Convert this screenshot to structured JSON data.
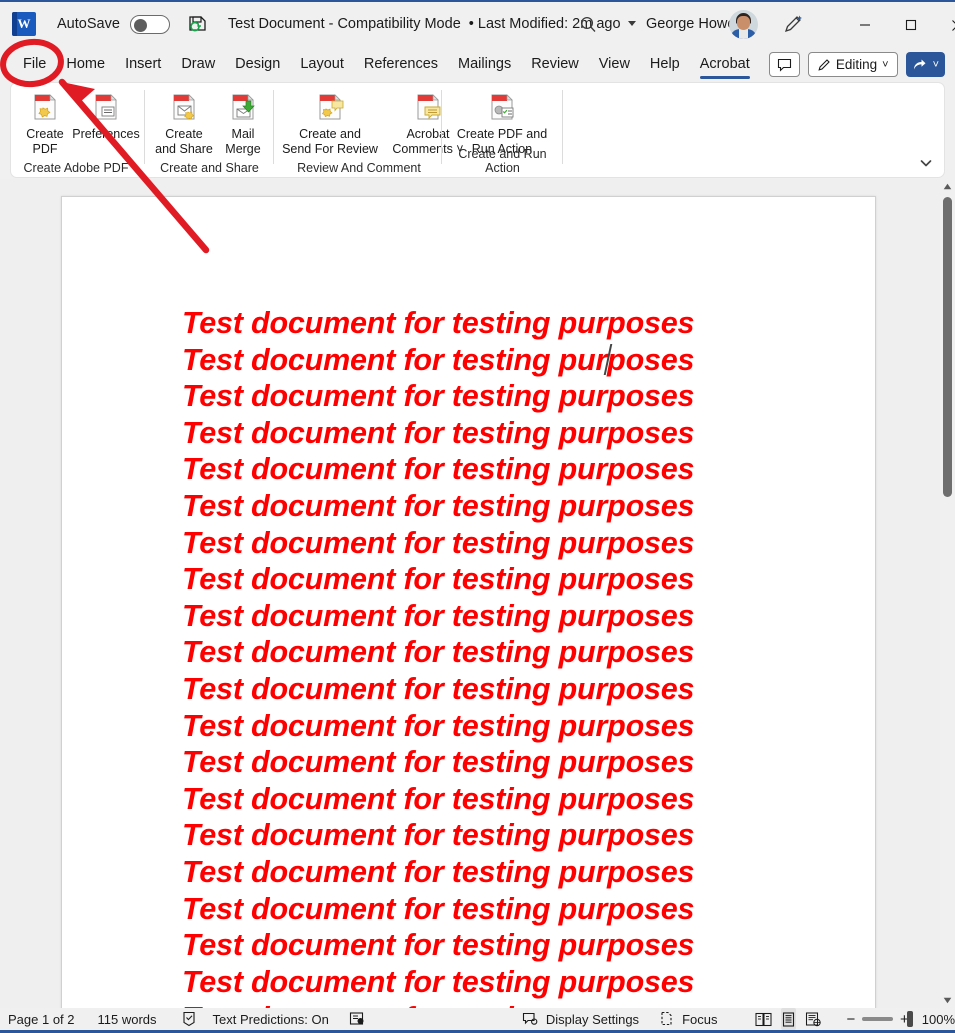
{
  "titlebar": {
    "app_logo": "word-logo",
    "autosave_label": "AutoSave",
    "autosave_state": "Off",
    "save_icon": "save-icon",
    "doc_name": "Test Document",
    "doc_dash": "-",
    "doc_mode": "Compatibility Mode",
    "doc_bullet": "•",
    "doc_modified": "Last Modified: 2m ago",
    "search_icon": "search-icon",
    "user_name": "George Howe",
    "avatar": "user-avatar",
    "pen_icon": "pen-icon",
    "minimize": "—",
    "maximize": "□",
    "close": "✕"
  },
  "tabs": [
    {
      "label": "File",
      "active": false
    },
    {
      "label": "Home",
      "active": false
    },
    {
      "label": "Insert",
      "active": false
    },
    {
      "label": "Draw",
      "active": false
    },
    {
      "label": "Design",
      "active": false
    },
    {
      "label": "Layout",
      "active": false
    },
    {
      "label": "References",
      "active": false
    },
    {
      "label": "Mailings",
      "active": false
    },
    {
      "label": "Review",
      "active": false
    },
    {
      "label": "View",
      "active": false
    },
    {
      "label": "Help",
      "active": false
    },
    {
      "label": "Acrobat",
      "active": true
    }
  ],
  "right_tools": {
    "comments_icon": "comment-icon",
    "editing_label": "Editing",
    "editing_icon": "pencil-icon",
    "editing_chevron": "chevron-down-icon",
    "share_icon": "share-icon",
    "share_chevron": "chevron-down-icon"
  },
  "ribbon": {
    "collapse_icon": "chevron-down-icon",
    "groups": [
      {
        "name": "Create Adobe PDF",
        "buttons": [
          {
            "label": "Create\nPDF",
            "icon": "create-pdf-icon"
          },
          {
            "label": "Preferences",
            "icon": "preferences-icon"
          }
        ]
      },
      {
        "name": "Create and Share",
        "buttons": [
          {
            "label": "Create\nand Share",
            "icon": "create-and-share-icon"
          },
          {
            "label": "Mail\nMerge",
            "icon": "mail-merge-icon"
          }
        ]
      },
      {
        "name": "Review And Comment",
        "buttons": [
          {
            "label": "Create and\nSend For Review",
            "icon": "send-for-review-icon"
          },
          {
            "label": "Acrobat\nComments ˅",
            "icon": "acrobat-comments-icon"
          }
        ]
      },
      {
        "name": "Create and Run Action",
        "buttons": [
          {
            "label": "Create PDF and\nRun Action",
            "icon": "create-pdf-run-action-icon"
          }
        ]
      }
    ]
  },
  "document": {
    "line_text": "Test document for testing purposes",
    "line_count": 20,
    "text_color": "#ff0000",
    "has_caret": true
  },
  "statusbar": {
    "page_label": "Page 1 of 2",
    "word_count": "115 words",
    "proofing_icon": "proofing-icon",
    "text_predictions": "Text Predictions: On",
    "accessibility_icon": "accessibility-icon",
    "display_settings": "Display Settings",
    "display_settings_icon": "display-settings-icon",
    "focus": "Focus",
    "focus_icon": "focus-icon",
    "views": [
      {
        "name": "read-mode",
        "selected": false
      },
      {
        "name": "print-layout",
        "selected": true
      },
      {
        "name": "web-layout",
        "selected": false
      }
    ],
    "zoom_out": "−",
    "zoom_in": "+",
    "zoom_level": "100%"
  },
  "annotation": {
    "color": "#e01b24",
    "circle_target": "File",
    "arrow": "points-to-file-tab"
  }
}
